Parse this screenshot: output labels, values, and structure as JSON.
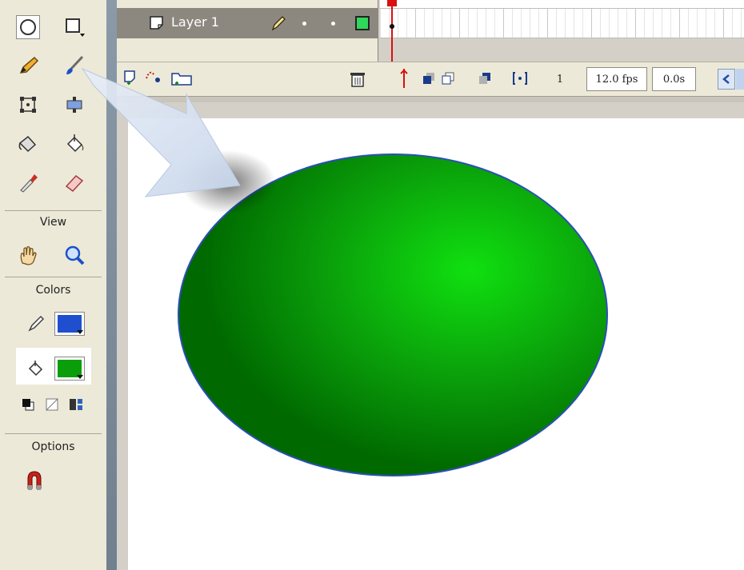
{
  "toolbox": {
    "tools": [
      {
        "name": "oval-tool-icon"
      },
      {
        "name": "rectangle-tool-icon"
      },
      {
        "name": "pencil-tool-icon"
      },
      {
        "name": "brush-tool-icon"
      },
      {
        "name": "free-transform-icon"
      },
      {
        "name": "fill-transform-icon"
      },
      {
        "name": "ink-bottle-icon"
      },
      {
        "name": "paint-bucket-icon"
      },
      {
        "name": "eyedropper-icon"
      },
      {
        "name": "eraser-icon"
      }
    ],
    "view_label": "View",
    "colors_label": "Colors",
    "options_label": "Options",
    "stroke_color": "#1f4ecf",
    "fill_color": "#0a9e0a"
  },
  "timeline": {
    "layer_name": "Layer 1",
    "current_frame": "1",
    "frame_rate": "12.0 fps",
    "elapsed_time": "0.0s"
  },
  "stage": {
    "shape_fill_light": "#10e010",
    "shape_fill_dark": "#006a00",
    "shape_stroke": "#2a4fb8"
  }
}
